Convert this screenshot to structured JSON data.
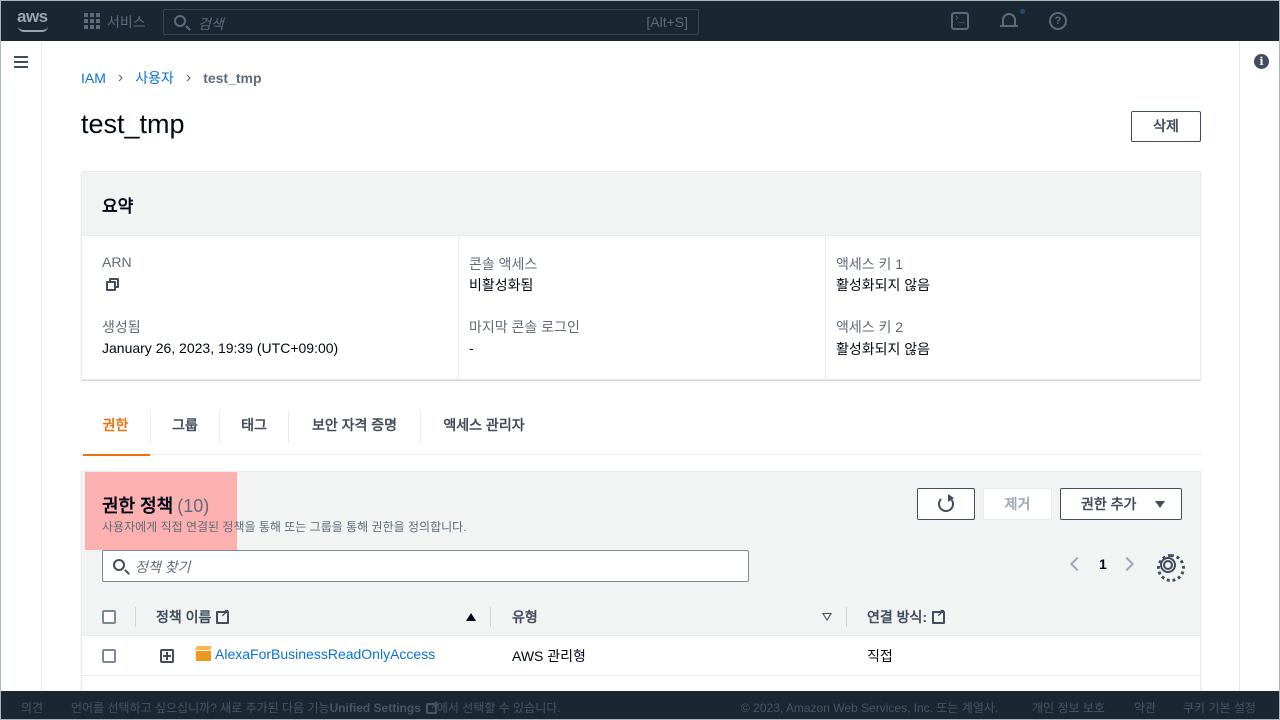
{
  "topbar": {
    "logo": "aws",
    "services_label": "서비스",
    "search_placeholder": "검색",
    "search_shortcut": "[Alt+S]",
    "icons": [
      "cloudshell-icon",
      "bell-icon",
      "help-icon"
    ]
  },
  "breadcrumb": {
    "items": [
      "IAM",
      "사용자"
    ],
    "current": "test_tmp"
  },
  "page": {
    "title": "test_tmp",
    "delete_label": "삭제"
  },
  "summary": {
    "title": "요약",
    "arn_label": "ARN",
    "created_label": "생성됨",
    "created_value": "January 26, 2023, 19:39 (UTC+09:00)",
    "console_access_label": "콘솔 액세스",
    "console_access_value": "비활성화됨",
    "last_login_label": "마지막 콘솔 로그인",
    "last_login_value": "-",
    "access_key1_label": "액세스 키 1",
    "access_key1_value": "활성화되지 않음",
    "access_key2_label": "액세스 키 2",
    "access_key2_value": "활성화되지 않음"
  },
  "tabs": [
    {
      "label": "권한",
      "active": true
    },
    {
      "label": "그룹",
      "active": false
    },
    {
      "label": "태그",
      "active": false
    },
    {
      "label": "보안 자격 증명",
      "active": false
    },
    {
      "label": "액세스 관리자",
      "active": false
    }
  ],
  "policies": {
    "title": "권한 정책",
    "count": "(10)",
    "description": "사용자에게 직접 연결된 정책을 통해 또는 그룹을 통해 권한을 정의합니다.",
    "remove_label": "제거",
    "add_label": "권한 추가",
    "filter_placeholder": "정책 찾기",
    "page": "1",
    "columns": {
      "name": "정책 이름",
      "type": "유형",
      "attached_via": "연결 방식:"
    },
    "rows": [
      {
        "name": "AlexaForBusinessReadOnlyAccess",
        "type": "AWS 관리형",
        "attached_via": "직접"
      }
    ]
  },
  "footer": {
    "feedback": "의견",
    "language_prompt": "언어를 선택하고 싶으십니까? 새로 추가된 다음 기능",
    "unified_settings": "Unified Settings",
    "language_prompt_tail": "에서 선택할 수 있습니다.",
    "copyright": "© 2023, Amazon Web Services, Inc. 또는 계열사.",
    "privacy": "개인 정보 보호",
    "terms": "약관",
    "cookies": "쿠키 기본 설정"
  },
  "colors": {
    "accent": "#ec7211",
    "link": "#0972d3",
    "topbar": "#232f3e",
    "highlight": "#ff9999"
  }
}
